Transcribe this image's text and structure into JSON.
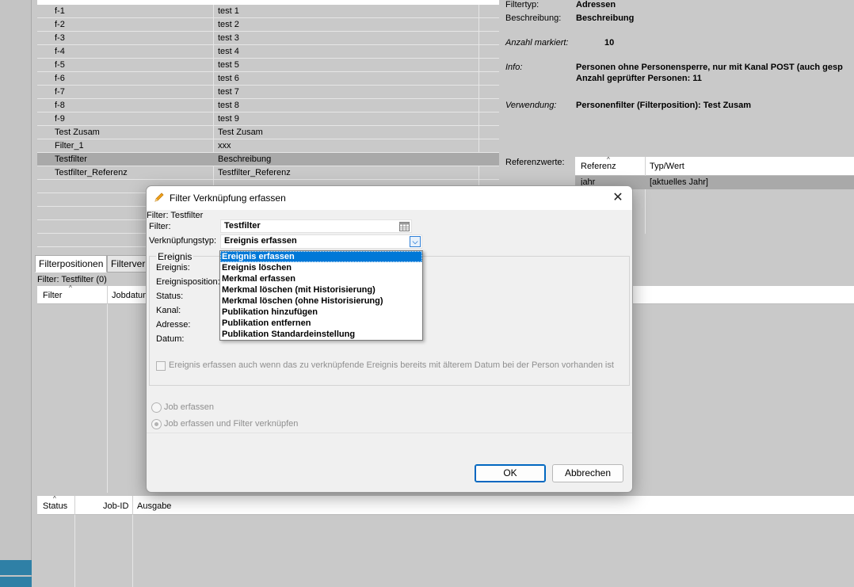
{
  "filters": {
    "rows": [
      {
        "name": "f-1",
        "desc": "test 1"
      },
      {
        "name": "f-2",
        "desc": "test 2"
      },
      {
        "name": "f-3",
        "desc": "test 3"
      },
      {
        "name": "f-4",
        "desc": "test 4"
      },
      {
        "name": "f-5",
        "desc": "test 5"
      },
      {
        "name": "f-6",
        "desc": "test 6"
      },
      {
        "name": "f-7",
        "desc": "test 7"
      },
      {
        "name": "f-8",
        "desc": "test 8"
      },
      {
        "name": "f-9",
        "desc": "test 9"
      },
      {
        "name": "Test Zusam",
        "desc": "Test Zusam"
      },
      {
        "name": "Filter_1",
        "desc": "xxx"
      },
      {
        "name": "Testfilter",
        "desc": "Beschreibung"
      },
      {
        "name": "Testfilter_Referenz",
        "desc": "Testfilter_Referenz"
      }
    ]
  },
  "info": {
    "filtertyp_label": "Filtertyp:",
    "filtertyp_value": "Adressen",
    "beschreibung_label": "Beschreibung:",
    "beschreibung_value": "Beschreibung",
    "anzahl_label": "Anzahl markiert:",
    "anzahl_value": "10",
    "info_label": "Info:",
    "info_line1": "Personen ohne Personensperre, nur mit Kanal POST (auch gesp",
    "info_line2": "Anzahl geprüfter Personen: 11",
    "verwendung_label": "Verwendung:",
    "verwendung_value": "Personenfilter (Filterposition): Test Zusam"
  },
  "referenz": {
    "label": "Referenzwerte:",
    "col1": "Referenz",
    "col2": "Typ/Wert",
    "row_name": "jahr",
    "row_value": "[aktuelles Jahr]"
  },
  "tabs": {
    "tab1": "Filterpositionen",
    "tab2": "Filterverk"
  },
  "positions": {
    "caption": "Filter: Testfilter (0)",
    "col1": "Filter",
    "col2": "Jobdatum"
  },
  "status_table": {
    "col1": "Status",
    "col2": "Job-ID",
    "col3": "Ausgabe"
  },
  "dialog": {
    "title": "Filter Verknüpfung erfassen",
    "subtitle": "Filter: Testfilter",
    "filter_label": "Filter:",
    "filter_value": "Testfilter",
    "typ_label": "Verknüpfungstyp:",
    "typ_value": "Ereignis erfassen",
    "group_title": "Ereignis",
    "ereignis_label": "Ereignis:",
    "ereignisposition_label": "Ereignisposition:",
    "status_label": "Status:",
    "kanal_label": "Kanal:",
    "adresse_label": "Adresse:",
    "datum_label": "Datum:",
    "checkbox_label": "Ereignis erfassen auch wenn das zu verknüpfende Ereignis bereits mit älterem Datum bei der Person vorhanden ist",
    "radio1": "Job erfassen",
    "radio2": "Job erfassen und Filter verknüpfen",
    "ok": "OK",
    "cancel": "Abbrechen"
  },
  "dropdown": {
    "options": [
      "Ereignis erfassen",
      "Ereignis löschen",
      "Merkmal erfassen",
      "Merkmal löschen (mit Historisierung)",
      "Merkmal löschen (ohne Historisierung)",
      "Publikation hinzufügen",
      "Publikation entfernen",
      "Publikation Standardeinstellung"
    ]
  }
}
